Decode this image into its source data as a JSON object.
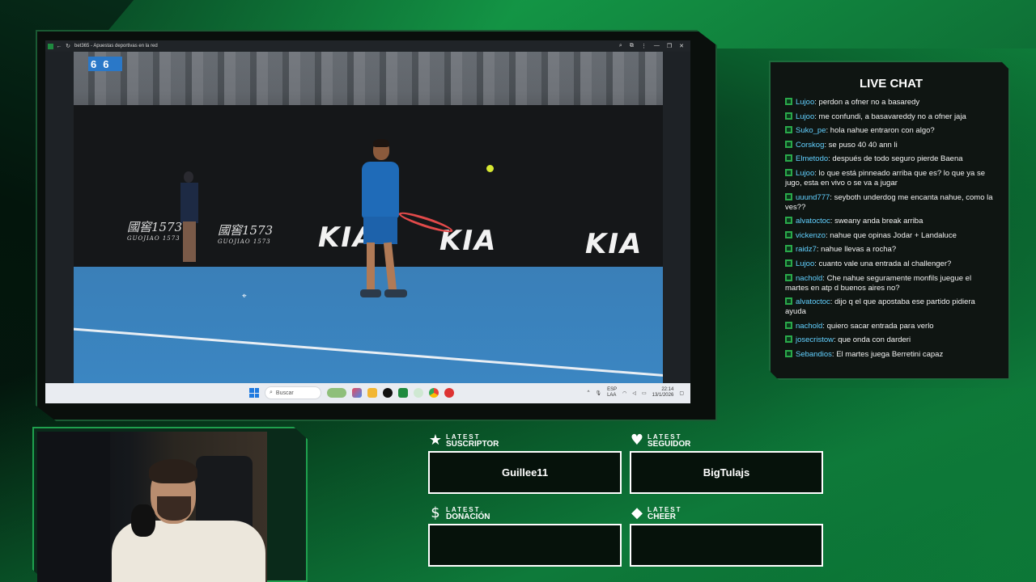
{
  "browser": {
    "tab_title": "bet365 - Apuestas deportivas en la red"
  },
  "video": {
    "score": [
      "6",
      "6"
    ],
    "sponsor_1": "國窖1573",
    "sponsor_1_sub": "GUOJIAO 1573",
    "sponsor_2": "國窖1573",
    "sponsor_2_sub": "GUOJIAO 1573",
    "brand": "KIA"
  },
  "taskbar": {
    "search_placeholder": "Buscar",
    "lang_1": "ESP",
    "lang_2": "LAA",
    "time": "22:14",
    "date": "13/1/2026"
  },
  "chat": {
    "title": "LIVE CHAT",
    "messages": [
      {
        "user": "Lujoo",
        "text": "perdon a ofner no a basaredy"
      },
      {
        "user": "Lujoo",
        "text": "me confundi, a basavareddy no a ofner jaja"
      },
      {
        "user": "Suko_pe",
        "text": "hola nahue entraron con algo?"
      },
      {
        "user": "Corskog",
        "text": "se puso 40 40 ann li"
      },
      {
        "user": "Elmetodo",
        "text": "después de todo seguro pierde Baena"
      },
      {
        "user": "Lujoo",
        "text": "lo que está pinneado arriba que es? lo que ya se jugo, esta en vivo o se va a jugar"
      },
      {
        "user": "uuund777",
        "text": "seyboth underdog me encanta nahue, como la ves??"
      },
      {
        "user": "alvatoctoc",
        "text": "sweany anda break arriba"
      },
      {
        "user": "vickenzo",
        "text": "nahue que opinas Jodar + Landaluce"
      },
      {
        "user": "raidz7",
        "text": "nahue llevas a rocha?"
      },
      {
        "user": "Lujoo",
        "text": "cuanto vale una entrada al challenger?"
      },
      {
        "user": "nachold",
        "text": "Che nahue seguramente monfils juegue el martes en atp d buenos aires no?"
      },
      {
        "user": "alvatoctoc",
        "text": "dijo q el que apostaba ese partido pidiera ayuda"
      },
      {
        "user": "nachold",
        "text": "quiero sacar entrada para verlo"
      },
      {
        "user": "josecristow",
        "text": "que onda con darderi"
      },
      {
        "user": "Sebandios",
        "text": "El martes juega Berretini capaz"
      }
    ]
  },
  "latest": {
    "subscriber": {
      "small": "LATEST",
      "big": "SUSCRIPTOR",
      "value": "Guillee11",
      "icon": "star-icon"
    },
    "follower": {
      "small": "LATEST",
      "big": "SEGUIDOR",
      "value": "BigTulajs",
      "icon": "heart-icon"
    },
    "donation": {
      "small": "LATEST",
      "big": "DONACIÓN",
      "value": "",
      "icon": "dollar-icon"
    },
    "cheer": {
      "small": "LATEST",
      "big": "CHEER",
      "value": "",
      "icon": "diamond-icon"
    }
  },
  "colors": {
    "accent_green": "#1fa04e",
    "chat_user": "#62d0ff"
  }
}
